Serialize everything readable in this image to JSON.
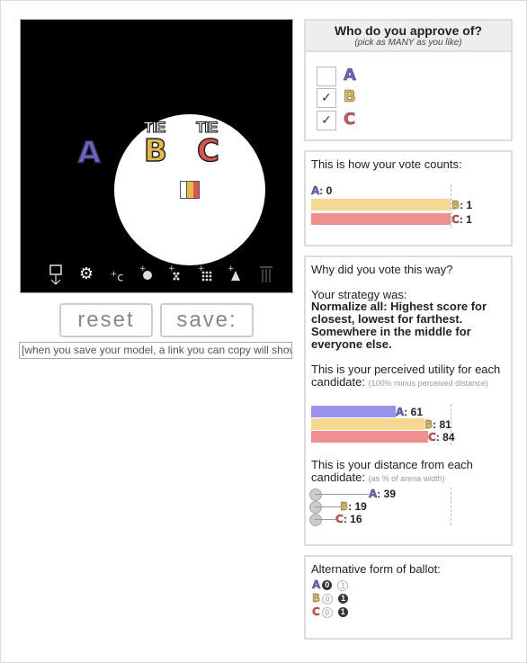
{
  "arena": {
    "candidates": [
      {
        "letter": "A",
        "tie": ""
      },
      {
        "letter": "B",
        "tie": "TIE"
      },
      {
        "letter": "C",
        "tie": "TIE"
      }
    ],
    "toolbar_icons": [
      "voter-tool-icon",
      "gear-icon",
      "add-candidate-icon",
      "bubble-icon",
      "scatter-icon",
      "grid-icon",
      "triangle-icon",
      "bars-icon"
    ]
  },
  "buttons": {
    "reset_label": "reset",
    "save_label": "save:",
    "link_placeholder": "[when you save your model, a link you can copy will show up here]"
  },
  "ballot": {
    "title": "Who do you approve of?",
    "subtitle": "(pick as MANY as you like)",
    "rows": [
      {
        "letter": "A",
        "checked": false,
        "mark": ""
      },
      {
        "letter": "B",
        "checked": true,
        "mark": "✓"
      },
      {
        "letter": "C",
        "checked": true,
        "mark": "✓"
      }
    ]
  },
  "counts": {
    "title": "This is how your vote counts:",
    "rows": [
      {
        "letter": "A",
        "value": "0",
        "frac": 0
      },
      {
        "letter": "B",
        "value": "1",
        "frac": 1
      },
      {
        "letter": "C",
        "value": "1",
        "frac": 1
      }
    ]
  },
  "why": {
    "title": "Why did you vote this way?",
    "strategy_label": "Your strategy was:",
    "strategy_text": "Normalize all: Highest score for closest, lowest for farthest. Somewhere in the middle for everyone else.",
    "utility_label": "This is your perceived utility for each candidate:",
    "utility_note": "(100% minus perceived distance)",
    "utility": [
      {
        "letter": "A",
        "value": "61"
      },
      {
        "letter": "B",
        "value": "81"
      },
      {
        "letter": "C",
        "value": "84"
      }
    ],
    "distance_label": "This is your distance from each candidate:",
    "distance_note": "(as % of arena width)",
    "distance": [
      {
        "letter": "A",
        "value": "39"
      },
      {
        "letter": "B",
        "value": "19"
      },
      {
        "letter": "C",
        "value": "16"
      }
    ]
  },
  "alt": {
    "title": "Alternative form of ballot:",
    "rows": [
      {
        "letter": "A",
        "zero": "0",
        "one": "1",
        "filled": "zero"
      },
      {
        "letter": "B",
        "zero": "0",
        "one": "1",
        "filled": "one"
      },
      {
        "letter": "C",
        "zero": "0",
        "one": "1",
        "filled": "one"
      }
    ]
  },
  "colors": {
    "A": "#6a62cc",
    "B": "#e5b84b",
    "C": "#dc5353"
  }
}
